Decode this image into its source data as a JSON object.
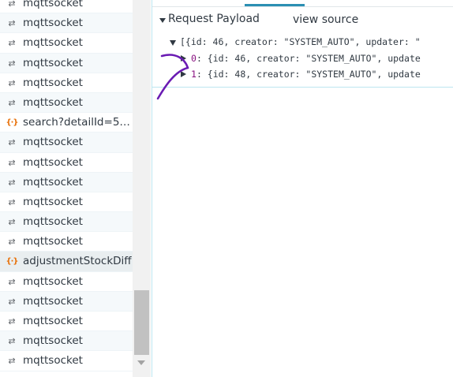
{
  "request_list": [
    {
      "label": "mqttsocket",
      "type": "websocket",
      "icon": "websocket-icon"
    },
    {
      "label": "mqttsocket",
      "type": "websocket",
      "icon": "websocket-icon"
    },
    {
      "label": "mqttsocket",
      "type": "websocket",
      "icon": "websocket-icon"
    },
    {
      "label": "mqttsocket",
      "type": "websocket",
      "icon": "websocket-icon"
    },
    {
      "label": "mqttsocket",
      "type": "websocket",
      "icon": "websocket-icon"
    },
    {
      "label": "mqttsocket",
      "type": "websocket",
      "icon": "websocket-icon"
    },
    {
      "label": "search?detailId=59...",
      "type": "xhr",
      "icon": "xhr-icon"
    },
    {
      "label": "mqttsocket",
      "type": "websocket",
      "icon": "websocket-icon"
    },
    {
      "label": "mqttsocket",
      "type": "websocket",
      "icon": "websocket-icon"
    },
    {
      "label": "mqttsocket",
      "type": "websocket",
      "icon": "websocket-icon"
    },
    {
      "label": "mqttsocket",
      "type": "websocket",
      "icon": "websocket-icon"
    },
    {
      "label": "mqttsocket",
      "type": "websocket",
      "icon": "websocket-icon"
    },
    {
      "label": "mqttsocket",
      "type": "websocket",
      "icon": "websocket-icon"
    },
    {
      "label": "adjustmentStockDiff",
      "type": "xhr",
      "icon": "xhr-icon",
      "selected": true
    },
    {
      "label": "mqttsocket",
      "type": "websocket",
      "icon": "websocket-icon"
    },
    {
      "label": "mqttsocket",
      "type": "websocket",
      "icon": "websocket-icon"
    },
    {
      "label": "mqttsocket",
      "type": "websocket",
      "icon": "websocket-icon"
    },
    {
      "label": "mqttsocket",
      "type": "websocket",
      "icon": "websocket-icon"
    },
    {
      "label": "mqttsocket",
      "type": "websocket",
      "icon": "websocket-icon"
    }
  ],
  "payload": {
    "section_title": "Request Payload",
    "view_source_label": "view source",
    "root_line": "[{id: 46, creator: \"SYSTEM_AUTO\", updater: \"",
    "items": [
      {
        "index": "0",
        "text": ": {id: 46, creator: \"SYSTEM_AUTO\", update"
      },
      {
        "index": "1",
        "text": ": {id: 48, creator: \"SYSTEM_AUTO\", update"
      }
    ]
  },
  "colors": {
    "accent": "#2b8fb3",
    "xhr_icon": "#e8710a",
    "array_index": "#881280",
    "annotation_stroke": "#6a1bb3"
  }
}
